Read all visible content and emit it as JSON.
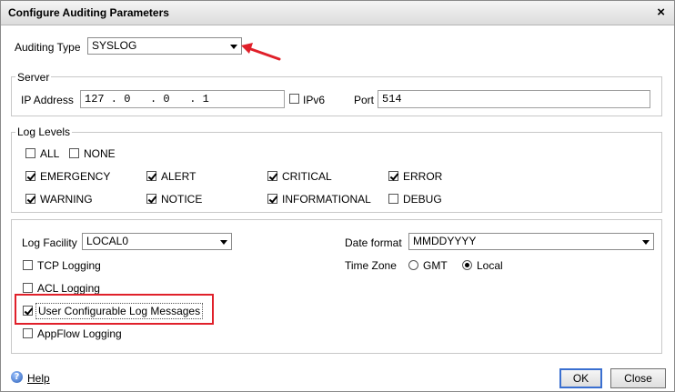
{
  "window": {
    "title": "Configure Auditing Parameters",
    "close_glyph": "×"
  },
  "auditing": {
    "label": "Auditing Type",
    "value": "SYSLOG"
  },
  "server": {
    "legend": "Server",
    "ip_label": "IP Address",
    "ip_value": "127 . 0   . 0   . 1",
    "ipv6_label": "IPv6",
    "ipv6_checked": false,
    "port_label": "Port",
    "port_value": "514"
  },
  "log_levels": {
    "legend": "Log Levels",
    "all": {
      "label": "ALL",
      "checked": false
    },
    "none": {
      "label": "NONE",
      "checked": false
    },
    "levels": [
      {
        "label": "EMERGENCY",
        "checked": true
      },
      {
        "label": "ALERT",
        "checked": true
      },
      {
        "label": "CRITICAL",
        "checked": true
      },
      {
        "label": "ERROR",
        "checked": true
      },
      {
        "label": "WARNING",
        "checked": true
      },
      {
        "label": "NOTICE",
        "checked": true
      },
      {
        "label": "INFORMATIONAL",
        "checked": true
      },
      {
        "label": "DEBUG",
        "checked": false
      }
    ]
  },
  "settings": {
    "log_facility_label": "Log Facility",
    "log_facility_value": "LOCAL0",
    "date_format_label": "Date format",
    "date_format_value": "MMDDYYYY",
    "time_zone_label": "Time Zone",
    "tz_gmt_label": "GMT",
    "tz_local_label": "Local",
    "tz_selected": "Local",
    "tcp_logging": {
      "label": "TCP Logging",
      "checked": false
    },
    "acl_logging": {
      "label": "ACL Logging",
      "checked": false
    },
    "user_config": {
      "label": "User Configurable Log Messages",
      "checked": true
    },
    "appflow": {
      "label": "AppFlow Logging",
      "checked": false
    }
  },
  "footer": {
    "help_label": "Help",
    "ok_label": "OK",
    "close_label": "Close"
  },
  "colors": {
    "annotation_red": "#e0202a",
    "default_button_border": "#3a6fd0"
  }
}
